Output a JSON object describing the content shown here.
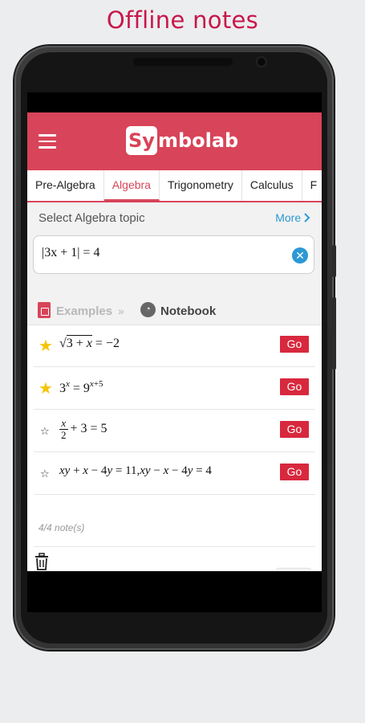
{
  "promo": {
    "title": "Offline notes"
  },
  "header": {
    "logo_box": "Sy",
    "logo_rest": "mbolab"
  },
  "tabs": [
    {
      "label": "Pre-Algebra",
      "active": false
    },
    {
      "label": "Algebra",
      "active": true
    },
    {
      "label": "Trigonometry",
      "active": false
    },
    {
      "label": "Calculus",
      "active": false
    },
    {
      "label": "F",
      "active": false
    }
  ],
  "topic": {
    "label": "Select Algebra topic",
    "more": "More"
  },
  "input": {
    "value": "|3x + 1| = 4"
  },
  "section_tabs": {
    "examples": "Examples",
    "notebook": "Notebook"
  },
  "notes": [
    {
      "starred": true,
      "expr": "√(3 + x) = −2",
      "go": "Go"
    },
    {
      "starred": true,
      "expr": "3^x = 9^(x+5)",
      "go": "Go"
    },
    {
      "starred": false,
      "expr": "x/2 + 3 = 5",
      "go": "Go"
    },
    {
      "starred": false,
      "expr": "xy + x − 4y = 11, xy − x − 4y = 4",
      "go": "Go"
    }
  ],
  "notes_count": "4/4 note(s)",
  "colors": {
    "brand": "#d84459",
    "go_button": "#d8283e",
    "link": "#2c98d6",
    "star": "#f5c400",
    "promo_title": "#c8174a"
  }
}
